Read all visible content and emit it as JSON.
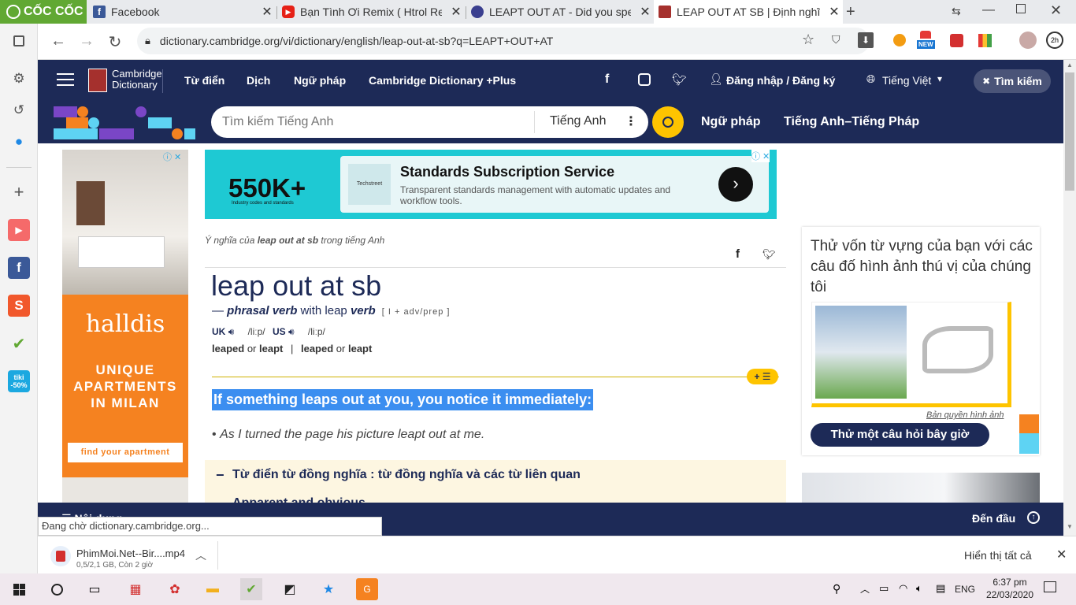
{
  "browser": {
    "brand": "CỐC CỐC",
    "tabs": [
      {
        "title": "Facebook",
        "icon": "facebook-icon",
        "color": "#3b5998"
      },
      {
        "title": "Bạn Tình Ơi Remix ( Htrol Rem",
        "icon": "youtube-icon",
        "color": "#e62117"
      },
      {
        "title": "LEAPT OUT AT - Did you spell",
        "icon": "globe-icon",
        "color": "#3a3f8f"
      },
      {
        "title": "LEAP OUT AT SB | Định nghĩa",
        "icon": "cambridge-icon",
        "color": "#a5302d"
      }
    ],
    "url": "dictionary.cambridge.org/vi/dictionary/english/leap-out-at-sb?q=LEAPT+OUT+AT",
    "profile_badge": "2h",
    "new_badge": "NEW"
  },
  "site": {
    "logo_line1": "Cambridge",
    "logo_line2": "Dictionary",
    "nav": [
      "Từ điển",
      "Dịch",
      "Ngữ pháp",
      "Cambridge Dictionary +Plus"
    ],
    "login": "Đăng nhập / Đăng ký",
    "language": "Tiếng Việt",
    "search_button": "Tìm kiếm",
    "search_placeholder": "Tìm kiếm Tiếng Anh",
    "search_lang": "Tiếng Anh",
    "sub_nav": [
      "Ngữ pháp",
      "Tiếng Anh–Tiếng Pháp"
    ]
  },
  "ad_top": {
    "big": "550K+",
    "small": "Industry codes and standards",
    "logo": "Techstreet",
    "title": "Standards Subscription Service",
    "desc": "Transparent standards management with automatic updates and workflow tools."
  },
  "ad_left": {
    "brand": "halldis",
    "line1": "UNIQUE",
    "line2": "APARTMENTS",
    "line3": "IN MILAN",
    "cta": "find your apartment"
  },
  "entry": {
    "meaning_prefix": "Ý nghĩa của ",
    "meaning_term": "leap out at sb",
    "meaning_suffix": " trong tiếng Anh",
    "headword": "leap out at sb",
    "dash": "— ",
    "pos": "phrasal verb",
    "with": " with leap ",
    "pos2": "verb",
    "grammar": "[ I + adv/prep ]",
    "uk": "UK",
    "us": "US",
    "ipa_uk": "/liːp/",
    "ipa_us": "/liːp/",
    "form1": "leaped",
    "or": "or",
    "form2": "leapt",
    "sep": "|",
    "form3": "leaped",
    "form4": "leapt",
    "definition": "If something leaps out at you, you notice it immediately:",
    "bullet": "•",
    "example": "As I turned the page his picture leapt out at me.",
    "thesaurus_minus": "−",
    "thesaurus": "Từ điển từ đồng nghĩa : từ đồng nghĩa và các từ liên quan",
    "thesaurus_sub": "Apparent and obvious"
  },
  "quiz": {
    "text": "Thử vốn từ vựng của bạn với các câu đố hình ảnh thú vị của chúng tôi",
    "credit": "Bản quyền hình ảnh",
    "button": "Thử một câu hỏi bây giờ"
  },
  "bottom_bar": {
    "left": "Nội dung",
    "back_to_top": "Đến đầu"
  },
  "status": "Đang chờ dictionary.cambridge.org...",
  "download": {
    "name": "PhimMoi.Net--Bir....mp4",
    "detail": "0,5/2,1 GB, Còn 2 giờ",
    "show_all": "Hiển thị tất cả"
  },
  "taskbar": {
    "lang": "ENG",
    "time": "6:37 pm",
    "date": "22/03/2020"
  }
}
